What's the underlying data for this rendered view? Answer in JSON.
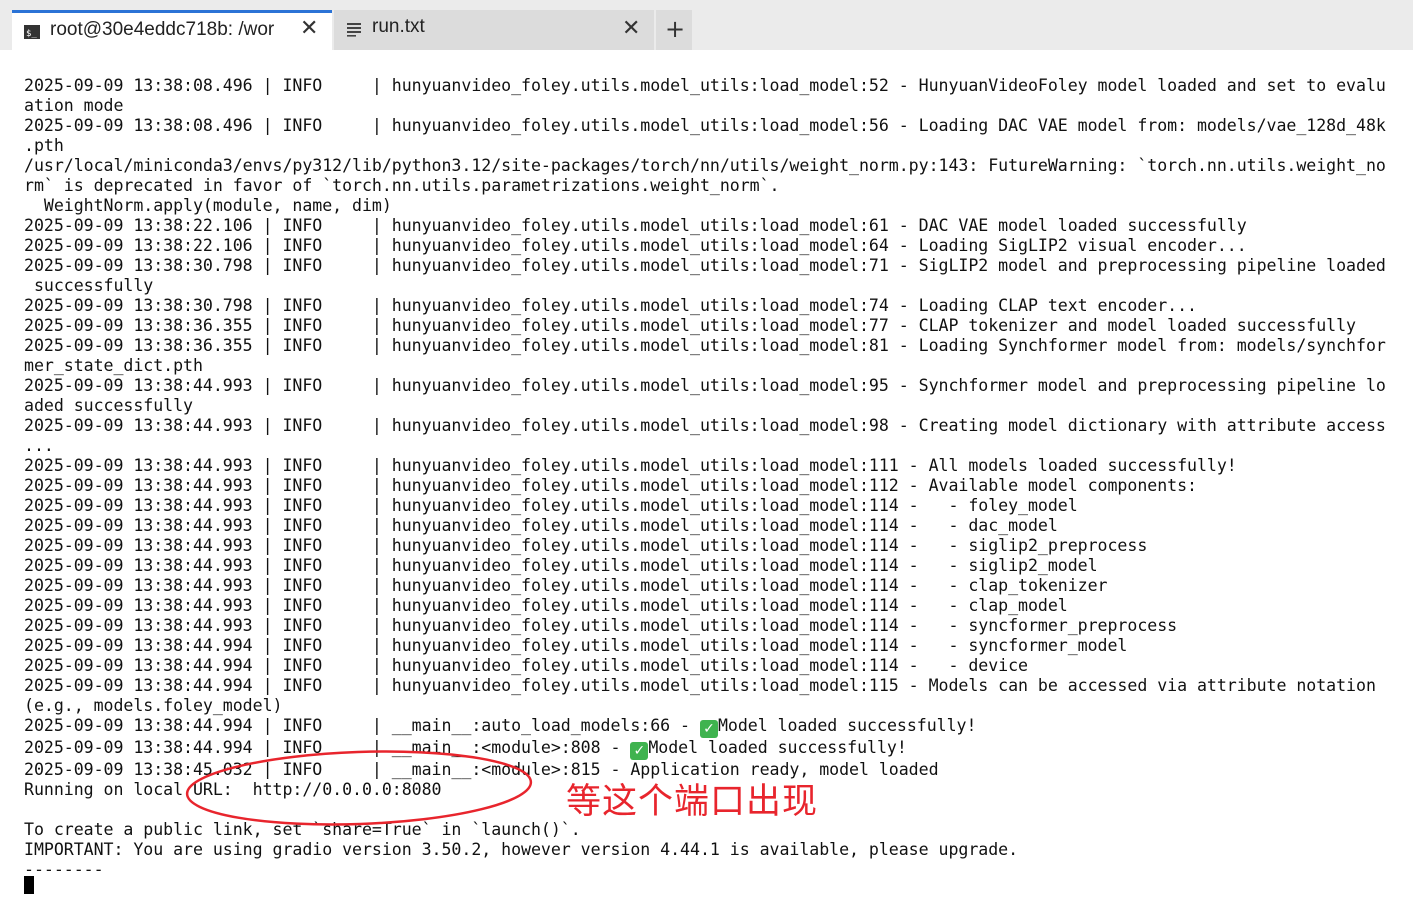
{
  "tabs": [
    {
      "title": "root@30e4eddc718b: /wor",
      "icon": "terminal-icon",
      "active": true
    },
    {
      "title": "run.txt",
      "icon": "text-file-icon",
      "active": false
    }
  ],
  "tab_close_glyph": "✕",
  "new_tab_glyph": "+",
  "log_lines": [
    "2025-09-09 13:38:08.496 | INFO     | hunyuanvideo_foley.utils.model_utils:load_model:52 - HunyuanVideoFoley model loaded and set to evalu",
    "ation mode",
    "2025-09-09 13:38:08.496 | INFO     | hunyuanvideo_foley.utils.model_utils:load_model:56 - Loading DAC VAE model from: models/vae_128d_48k",
    ".pth",
    "/usr/local/miniconda3/envs/py312/lib/python3.12/site-packages/torch/nn/utils/weight_norm.py:143: FutureWarning: `torch.nn.utils.weight_no",
    "rm` is deprecated in favor of `torch.nn.utils.parametrizations.weight_norm`.",
    "  WeightNorm.apply(module, name, dim)",
    "2025-09-09 13:38:22.106 | INFO     | hunyuanvideo_foley.utils.model_utils:load_model:61 - DAC VAE model loaded successfully",
    "2025-09-09 13:38:22.106 | INFO     | hunyuanvideo_foley.utils.model_utils:load_model:64 - Loading SigLIP2 visual encoder...",
    "2025-09-09 13:38:30.798 | INFO     | hunyuanvideo_foley.utils.model_utils:load_model:71 - SigLIP2 model and preprocessing pipeline loaded",
    " successfully",
    "2025-09-09 13:38:30.798 | INFO     | hunyuanvideo_foley.utils.model_utils:load_model:74 - Loading CLAP text encoder...",
    "2025-09-09 13:38:36.355 | INFO     | hunyuanvideo_foley.utils.model_utils:load_model:77 - CLAP tokenizer and model loaded successfully",
    "2025-09-09 13:38:36.355 | INFO     | hunyuanvideo_foley.utils.model_utils:load_model:81 - Loading Synchformer model from: models/synchfor",
    "mer_state_dict.pth",
    "2025-09-09 13:38:44.993 | INFO     | hunyuanvideo_foley.utils.model_utils:load_model:95 - Synchformer model and preprocessing pipeline lo",
    "aded successfully",
    "2025-09-09 13:38:44.993 | INFO     | hunyuanvideo_foley.utils.model_utils:load_model:98 - Creating model dictionary with attribute access",
    "...",
    "2025-09-09 13:38:44.993 | INFO     | hunyuanvideo_foley.utils.model_utils:load_model:111 - All models loaded successfully!",
    "2025-09-09 13:38:44.993 | INFO     | hunyuanvideo_foley.utils.model_utils:load_model:112 - Available model components:",
    "2025-09-09 13:38:44.993 | INFO     | hunyuanvideo_foley.utils.model_utils:load_model:114 -   - foley_model",
    "2025-09-09 13:38:44.993 | INFO     | hunyuanvideo_foley.utils.model_utils:load_model:114 -   - dac_model",
    "2025-09-09 13:38:44.993 | INFO     | hunyuanvideo_foley.utils.model_utils:load_model:114 -   - siglip2_preprocess",
    "2025-09-09 13:38:44.993 | INFO     | hunyuanvideo_foley.utils.model_utils:load_model:114 -   - siglip2_model",
    "2025-09-09 13:38:44.993 | INFO     | hunyuanvideo_foley.utils.model_utils:load_model:114 -   - clap_tokenizer",
    "2025-09-09 13:38:44.993 | INFO     | hunyuanvideo_foley.utils.model_utils:load_model:114 -   - clap_model",
    "2025-09-09 13:38:44.993 | INFO     | hunyuanvideo_foley.utils.model_utils:load_model:114 -   - syncformer_preprocess",
    "2025-09-09 13:38:44.994 | INFO     | hunyuanvideo_foley.utils.model_utils:load_model:114 -   - syncformer_model",
    "2025-09-09 13:38:44.994 | INFO     | hunyuanvideo_foley.utils.model_utils:load_model:114 -   - device",
    "2025-09-09 13:38:44.994 | INFO     | hunyuanvideo_foley.utils.model_utils:load_model:115 - Models can be accessed via attribute notation",
    "(e.g., models.foley_model)",
    "2025-09-09 13:38:44.994 | INFO     | __main__:auto_load_models:66 - ✅Model loaded successfully!",
    "2025-09-09 13:38:44.994 | INFO     | __main__:<module>:808 - ✅Model loaded successfully!",
    "2025-09-09 13:38:45.032 | INFO     | __main__:<module>:815 - Application ready, model loaded",
    "Running on local URL:  http://0.0.0.0:8080",
    "",
    "To create a public link, set `share=True` in `launch()`.",
    "IMPORTANT: You are using gradio version 3.50.2, however version 4.44.1 is available, please upgrade.",
    "--------"
  ],
  "annotation": {
    "text": "等这个端口出现",
    "color": "#e8252d"
  }
}
